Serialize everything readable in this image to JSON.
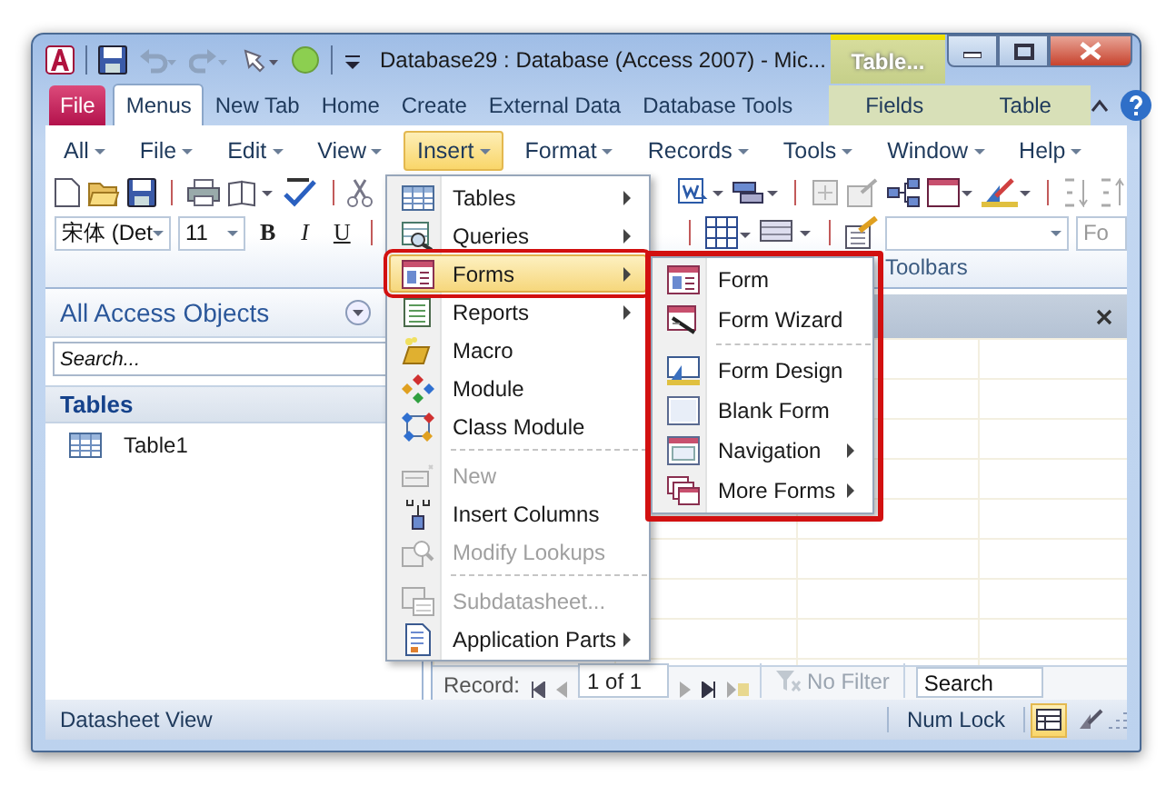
{
  "window": {
    "title": "Database29 : Database (Access 2007)  -  Mic...",
    "context_tab": "Table..."
  },
  "ribbon_tabs": [
    {
      "label": "File",
      "kind": "file",
      "selected": false
    },
    {
      "label": "Menus",
      "kind": "normal",
      "selected": true
    },
    {
      "label": "New Tab",
      "kind": "normal",
      "selected": false
    },
    {
      "label": "Home",
      "kind": "normal",
      "selected": false
    },
    {
      "label": "Create",
      "kind": "normal",
      "selected": false
    },
    {
      "label": "External Data",
      "kind": "normal",
      "selected": false
    },
    {
      "label": "Database Tools",
      "kind": "normal",
      "selected": false
    },
    {
      "label": "Fields",
      "kind": "contextual",
      "selected": false
    },
    {
      "label": "Table",
      "kind": "contextual",
      "selected": false
    }
  ],
  "menu_bar": [
    {
      "label": "All",
      "selected": false
    },
    {
      "label": "File",
      "selected": false
    },
    {
      "label": "Edit",
      "selected": false
    },
    {
      "label": "View",
      "selected": false
    },
    {
      "label": "Insert",
      "selected": true
    },
    {
      "label": "Format",
      "selected": false
    },
    {
      "label": "Records",
      "selected": false
    },
    {
      "label": "Tools",
      "selected": false
    },
    {
      "label": "Window",
      "selected": false
    },
    {
      "label": "Help",
      "selected": false
    }
  ],
  "toolbar": {
    "font": "宋体 (Det",
    "size": "11",
    "bold": "B",
    "italic": "I",
    "underline": "U",
    "font_right": "Fo",
    "group_label": "Toolbars"
  },
  "nav_pane": {
    "title": "All Access Objects",
    "search": {
      "placeholder": "Search..."
    },
    "groups": [
      {
        "label": "Tables",
        "items": [
          "Table1"
        ]
      }
    ]
  },
  "record_bar": {
    "label": "Record:",
    "position": "1 of 1",
    "filter": "No Filter",
    "search": {
      "placeholder": "Search"
    }
  },
  "status_bar": {
    "text": "Datasheet View",
    "indicator": "Num Lock",
    "views": [
      {
        "selected": true
      },
      {
        "selected": false
      }
    ]
  },
  "insert_menu": [
    {
      "kind": "item",
      "label": "Tables",
      "submenu": true,
      "disabled": false,
      "selected": false
    },
    {
      "kind": "item",
      "label": "Queries",
      "submenu": true,
      "disabled": false,
      "selected": false
    },
    {
      "kind": "item",
      "label": "Forms",
      "submenu": true,
      "disabled": false,
      "selected": true
    },
    {
      "kind": "item",
      "label": "Reports",
      "submenu": true,
      "disabled": false,
      "selected": false
    },
    {
      "kind": "item",
      "label": "Macro",
      "submenu": false,
      "disabled": false,
      "selected": false
    },
    {
      "kind": "item",
      "label": "Module",
      "submenu": false,
      "disabled": false,
      "selected": false
    },
    {
      "kind": "item",
      "label": "Class Module",
      "submenu": false,
      "disabled": false,
      "selected": false
    },
    {
      "kind": "separator"
    },
    {
      "kind": "item",
      "label": "New",
      "submenu": false,
      "disabled": true,
      "selected": false
    },
    {
      "kind": "item",
      "label": "Insert Columns",
      "submenu": false,
      "disabled": false,
      "selected": false
    },
    {
      "kind": "item",
      "label": "Modify Lookups",
      "submenu": false,
      "disabled": true,
      "selected": false
    },
    {
      "kind": "separator"
    },
    {
      "kind": "item",
      "label": "Subdatasheet...",
      "submenu": false,
      "disabled": true,
      "selected": false
    },
    {
      "kind": "item",
      "label": "Application Parts",
      "submenu": true,
      "disabled": false,
      "selected": false
    }
  ],
  "forms_submenu": {
    "highlighted": true,
    "items": [
      {
        "kind": "item",
        "label": "Form",
        "submenu": false
      },
      {
        "kind": "item",
        "label": "Form Wizard",
        "submenu": false
      },
      {
        "kind": "separator"
      },
      {
        "kind": "item",
        "label": "Form Design",
        "submenu": false
      },
      {
        "kind": "item",
        "label": "Blank Form",
        "submenu": false
      },
      {
        "kind": "item",
        "label": "Navigation",
        "submenu": true
      },
      {
        "kind": "item",
        "label": "More Forms",
        "submenu": true
      }
    ]
  }
}
